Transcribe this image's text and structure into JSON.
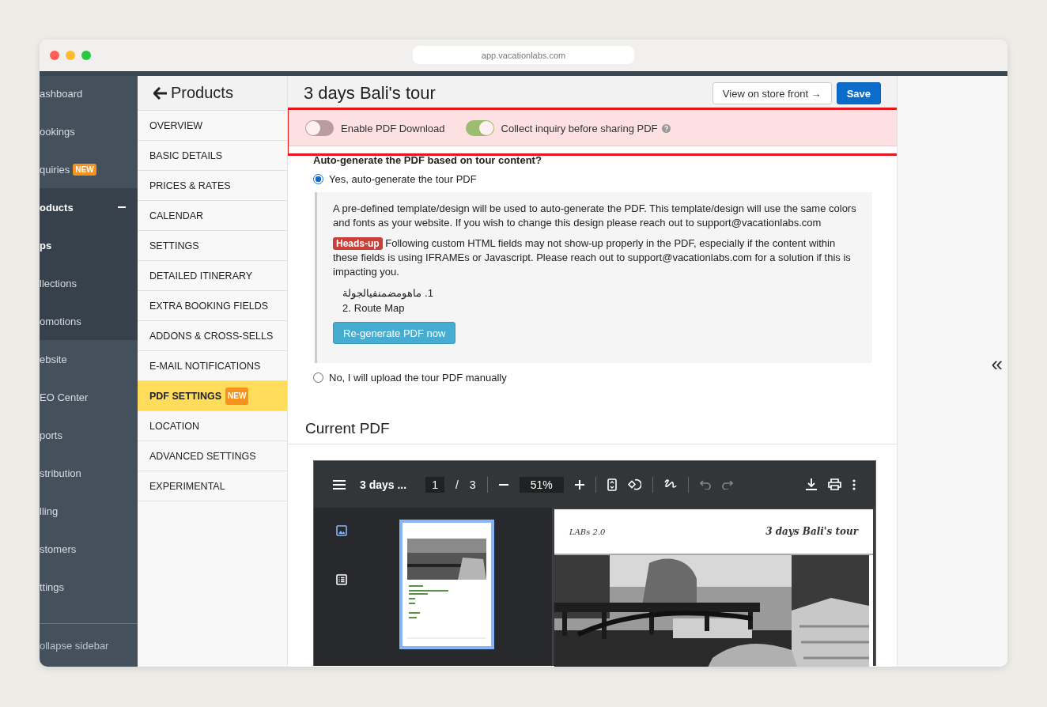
{
  "browser": {
    "url": "app.vacationlabs.com"
  },
  "sidebar": {
    "items": [
      {
        "label": "ashboard",
        "selected": false
      },
      {
        "label": "ookings",
        "selected": false
      },
      {
        "label": "quiries",
        "selected": false,
        "badge": "NEW"
      },
      {
        "label": "oducts",
        "selected": true,
        "expanded": true,
        "children": [
          {
            "label": "ps",
            "selected": true
          },
          {
            "label": "llections",
            "selected": false
          },
          {
            "label": "omotions",
            "selected": false
          }
        ]
      },
      {
        "label": "ebsite",
        "selected": false
      },
      {
        "label": "EO Center",
        "selected": false
      },
      {
        "label": "ports",
        "selected": false
      },
      {
        "label": "stribution",
        "selected": false
      },
      {
        "label": "lling",
        "selected": false
      },
      {
        "label": "stomers",
        "selected": false
      },
      {
        "label": "ttings",
        "selected": false
      }
    ],
    "collapse": "ollapse sidebar"
  },
  "subnav": {
    "title": "Products",
    "items": [
      {
        "label": "OVERVIEW",
        "selected": false
      },
      {
        "label": "BASIC DETAILS",
        "selected": false
      },
      {
        "label": "PRICES & RATES",
        "selected": false
      },
      {
        "label": "CALENDAR",
        "selected": false
      },
      {
        "label": "SETTINGS",
        "selected": false
      },
      {
        "label": "DETAILED ITINERARY",
        "selected": false
      },
      {
        "label": "EXTRA BOOKING FIELDS",
        "selected": false
      },
      {
        "label": "ADDONS & CROSS-SELLS",
        "selected": false
      },
      {
        "label": "E-MAIL NOTIFICATIONS",
        "selected": false
      },
      {
        "label": "PDF SETTINGS",
        "selected": true,
        "badge": "NEW"
      },
      {
        "label": "LOCATION",
        "selected": false
      },
      {
        "label": "ADVANCED SETTINGS",
        "selected": false
      },
      {
        "label": "EXPERIMENTAL",
        "selected": false
      }
    ]
  },
  "page": {
    "title": "3 days Bali's tour",
    "buttons": [
      {
        "label": "View on store front →",
        "kind": "default"
      },
      {
        "label": "Save",
        "kind": "primary"
      }
    ]
  },
  "toggles": [
    {
      "label": "Enable PDF Download",
      "on": false,
      "help": false
    },
    {
      "label": "Collect inquiry before sharing PDF",
      "on": true,
      "help": true
    }
  ],
  "autogen": {
    "question": "Auto-generate the PDF based on tour content?",
    "options": [
      {
        "label": "Yes, auto-generate the tour PDF",
        "selected": true
      },
      {
        "label": "No, I will upload the tour PDF manually",
        "selected": false
      }
    ],
    "info": "A pre-defined template/design will be used to auto-generate the PDF. This template/design will use the same colors and fonts as your website. If you wish to change this design please reach out to support@vacationlabs.com",
    "warning_badge": "Heads-up",
    "warning": "Following custom HTML fields may not show-up properly in the PDF, especially if the content within these fields is using IFRAMEs or Javascript. Please reach out to support@vacationlabs.com for a solution if this is impacting you.",
    "fields": [
      {
        "number": "1.",
        "label": "ماهومضمنفيالجولة"
      },
      {
        "number": "2.",
        "label": "Route Map"
      }
    ],
    "regenerate_button": "Re-generate PDF now"
  },
  "current_pdf": {
    "heading": "Current PDF",
    "viewer": {
      "doc_title": "3 days ...",
      "page": "1",
      "page_separator": "/",
      "page_count": "3",
      "zoom": "51%",
      "views": [
        {
          "kind": "thumbnails",
          "selected": true
        },
        {
          "kind": "outline",
          "selected": false
        }
      ],
      "page_header_left": "LABs 2.0",
      "page_header_right": "3 days Bali's tour"
    }
  },
  "right_panel": {
    "expand_glyph": "«"
  }
}
